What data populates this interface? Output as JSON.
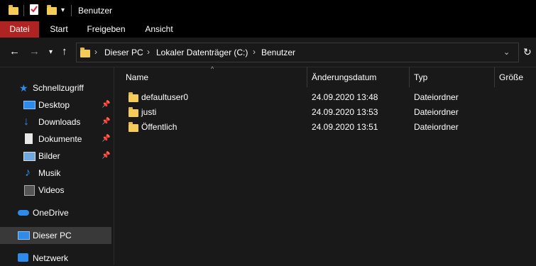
{
  "window": {
    "title": "Benutzer"
  },
  "ribbon": {
    "tabs": [
      "Datei",
      "Start",
      "Freigeben",
      "Ansicht"
    ]
  },
  "address": {
    "crumbs": [
      "Dieser PC",
      "Lokaler Datenträger (C:)",
      "Benutzer"
    ]
  },
  "sidebar": {
    "quick_access": "Schnellzugriff",
    "items": [
      {
        "label": "Desktop",
        "pinned": true
      },
      {
        "label": "Downloads",
        "pinned": true
      },
      {
        "label": "Dokumente",
        "pinned": true
      },
      {
        "label": "Bilder",
        "pinned": true
      },
      {
        "label": "Musik",
        "pinned": false
      },
      {
        "label": "Videos",
        "pinned": false
      }
    ],
    "onedrive": "OneDrive",
    "this_pc": "Dieser PC",
    "network": "Netzwerk"
  },
  "columns": {
    "name": "Name",
    "date": "Änderungsdatum",
    "type": "Typ",
    "size": "Größe"
  },
  "files": [
    {
      "name": "defaultuser0",
      "date": "24.09.2020 13:48",
      "type": "Dateiordner"
    },
    {
      "name": "justi",
      "date": "24.09.2020 13:53",
      "type": "Dateiordner"
    },
    {
      "name": "Öffentlich",
      "date": "24.09.2020 13:51",
      "type": "Dateiordner"
    }
  ],
  "colors": {
    "datei_tab": "#b02323",
    "folder": "#f6cc59",
    "accent": "#2d8ceb"
  }
}
